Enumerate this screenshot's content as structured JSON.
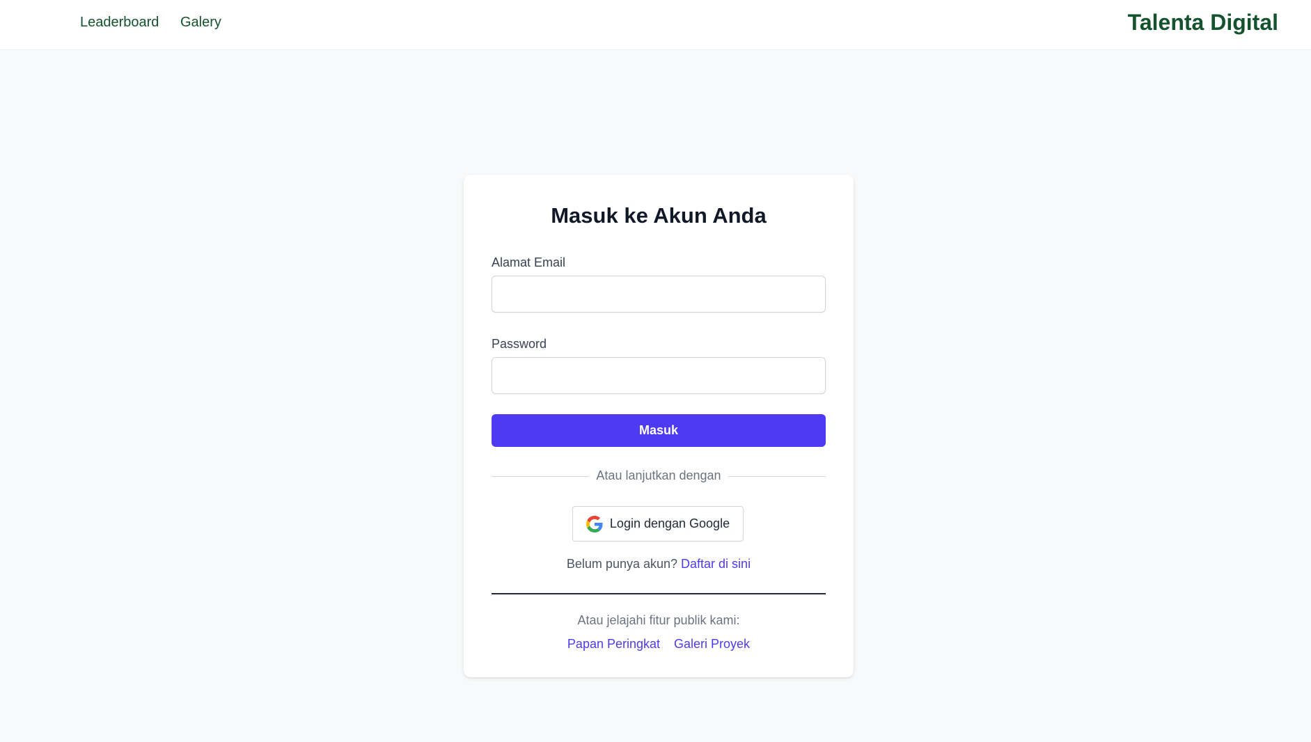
{
  "nav": {
    "links": [
      {
        "label": "Leaderboard"
      },
      {
        "label": "Galery"
      }
    ],
    "brand": "Talenta Digital"
  },
  "login": {
    "title": "Masuk ke Akun Anda",
    "email_label": "Alamat Email",
    "email_value": "",
    "password_label": "Password",
    "password_value": "",
    "submit_label": "Masuk",
    "divider_text": "Atau lanjutkan dengan",
    "google_label": "Login dengan Google",
    "google_icon": "google-icon",
    "register_prompt": "Belum punya akun?",
    "register_link": "Daftar di sini",
    "explore_text": "Atau jelajahi fitur publik kami:",
    "public_links": [
      {
        "label": "Papan Peringkat"
      },
      {
        "label": "Galeri Proyek"
      }
    ]
  },
  "colors": {
    "brand_green": "#14532d",
    "primary": "#4f3af4",
    "background": "#f8f9fa"
  }
}
